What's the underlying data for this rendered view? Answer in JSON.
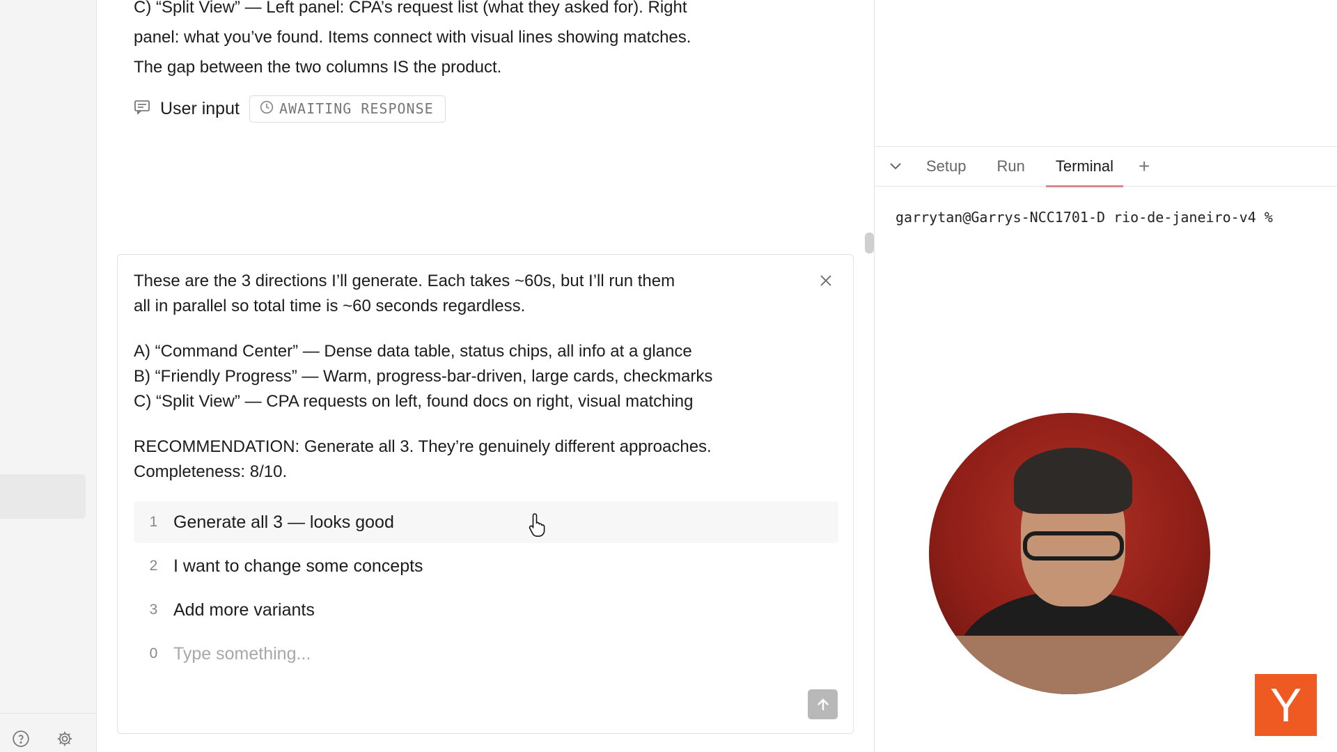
{
  "sidebar": {
    "help_icon": "question-circle-icon",
    "settings_icon": "gear-icon"
  },
  "chat": {
    "previous_message": {
      "line1": "C) “Split View” — Left panel: CPA’s request list (what they asked for). Right",
      "line2": "panel: what you’ve found. Items connect with visual lines showing matches.",
      "line3": "The gap between the two columns IS the product."
    },
    "user_input_label": "User input",
    "status_badge": "AWAITING RESPONSE"
  },
  "question": {
    "intro_line1": "These are the 3 directions I’ll generate. Each takes ~60s, but I’ll run them",
    "intro_line2": "all in parallel so total time is ~60 seconds regardless.",
    "direction_a": "A) “Command Center” — Dense data table, status chips, all info at a glance",
    "direction_b": "B) “Friendly Progress” — Warm, progress-bar-driven, large cards, checkmarks",
    "direction_c": "C) “Split View” — CPA requests on left, found docs on right, visual matching",
    "recommendation_line1": "RECOMMENDATION: Generate all 3. They’re genuinely different approaches.",
    "recommendation_line2": "Completeness: 8/10.",
    "options": [
      {
        "num": "1",
        "label": "Generate all 3 — looks good"
      },
      {
        "num": "2",
        "label": "I want to change some concepts"
      },
      {
        "num": "3",
        "label": "Add more variants"
      }
    ],
    "custom_option": {
      "num": "0",
      "placeholder": "Type something..."
    }
  },
  "panel": {
    "tabs": [
      "Setup",
      "Run",
      "Terminal"
    ],
    "active_tab": "Terminal",
    "add_tab": "+",
    "terminal_prompt": "garrytan@Garrys-NCC1701-D rio-de-janeiro-v4 %"
  },
  "overlay": {
    "logo_letter": "Y",
    "logo_color": "#ef5a23"
  }
}
